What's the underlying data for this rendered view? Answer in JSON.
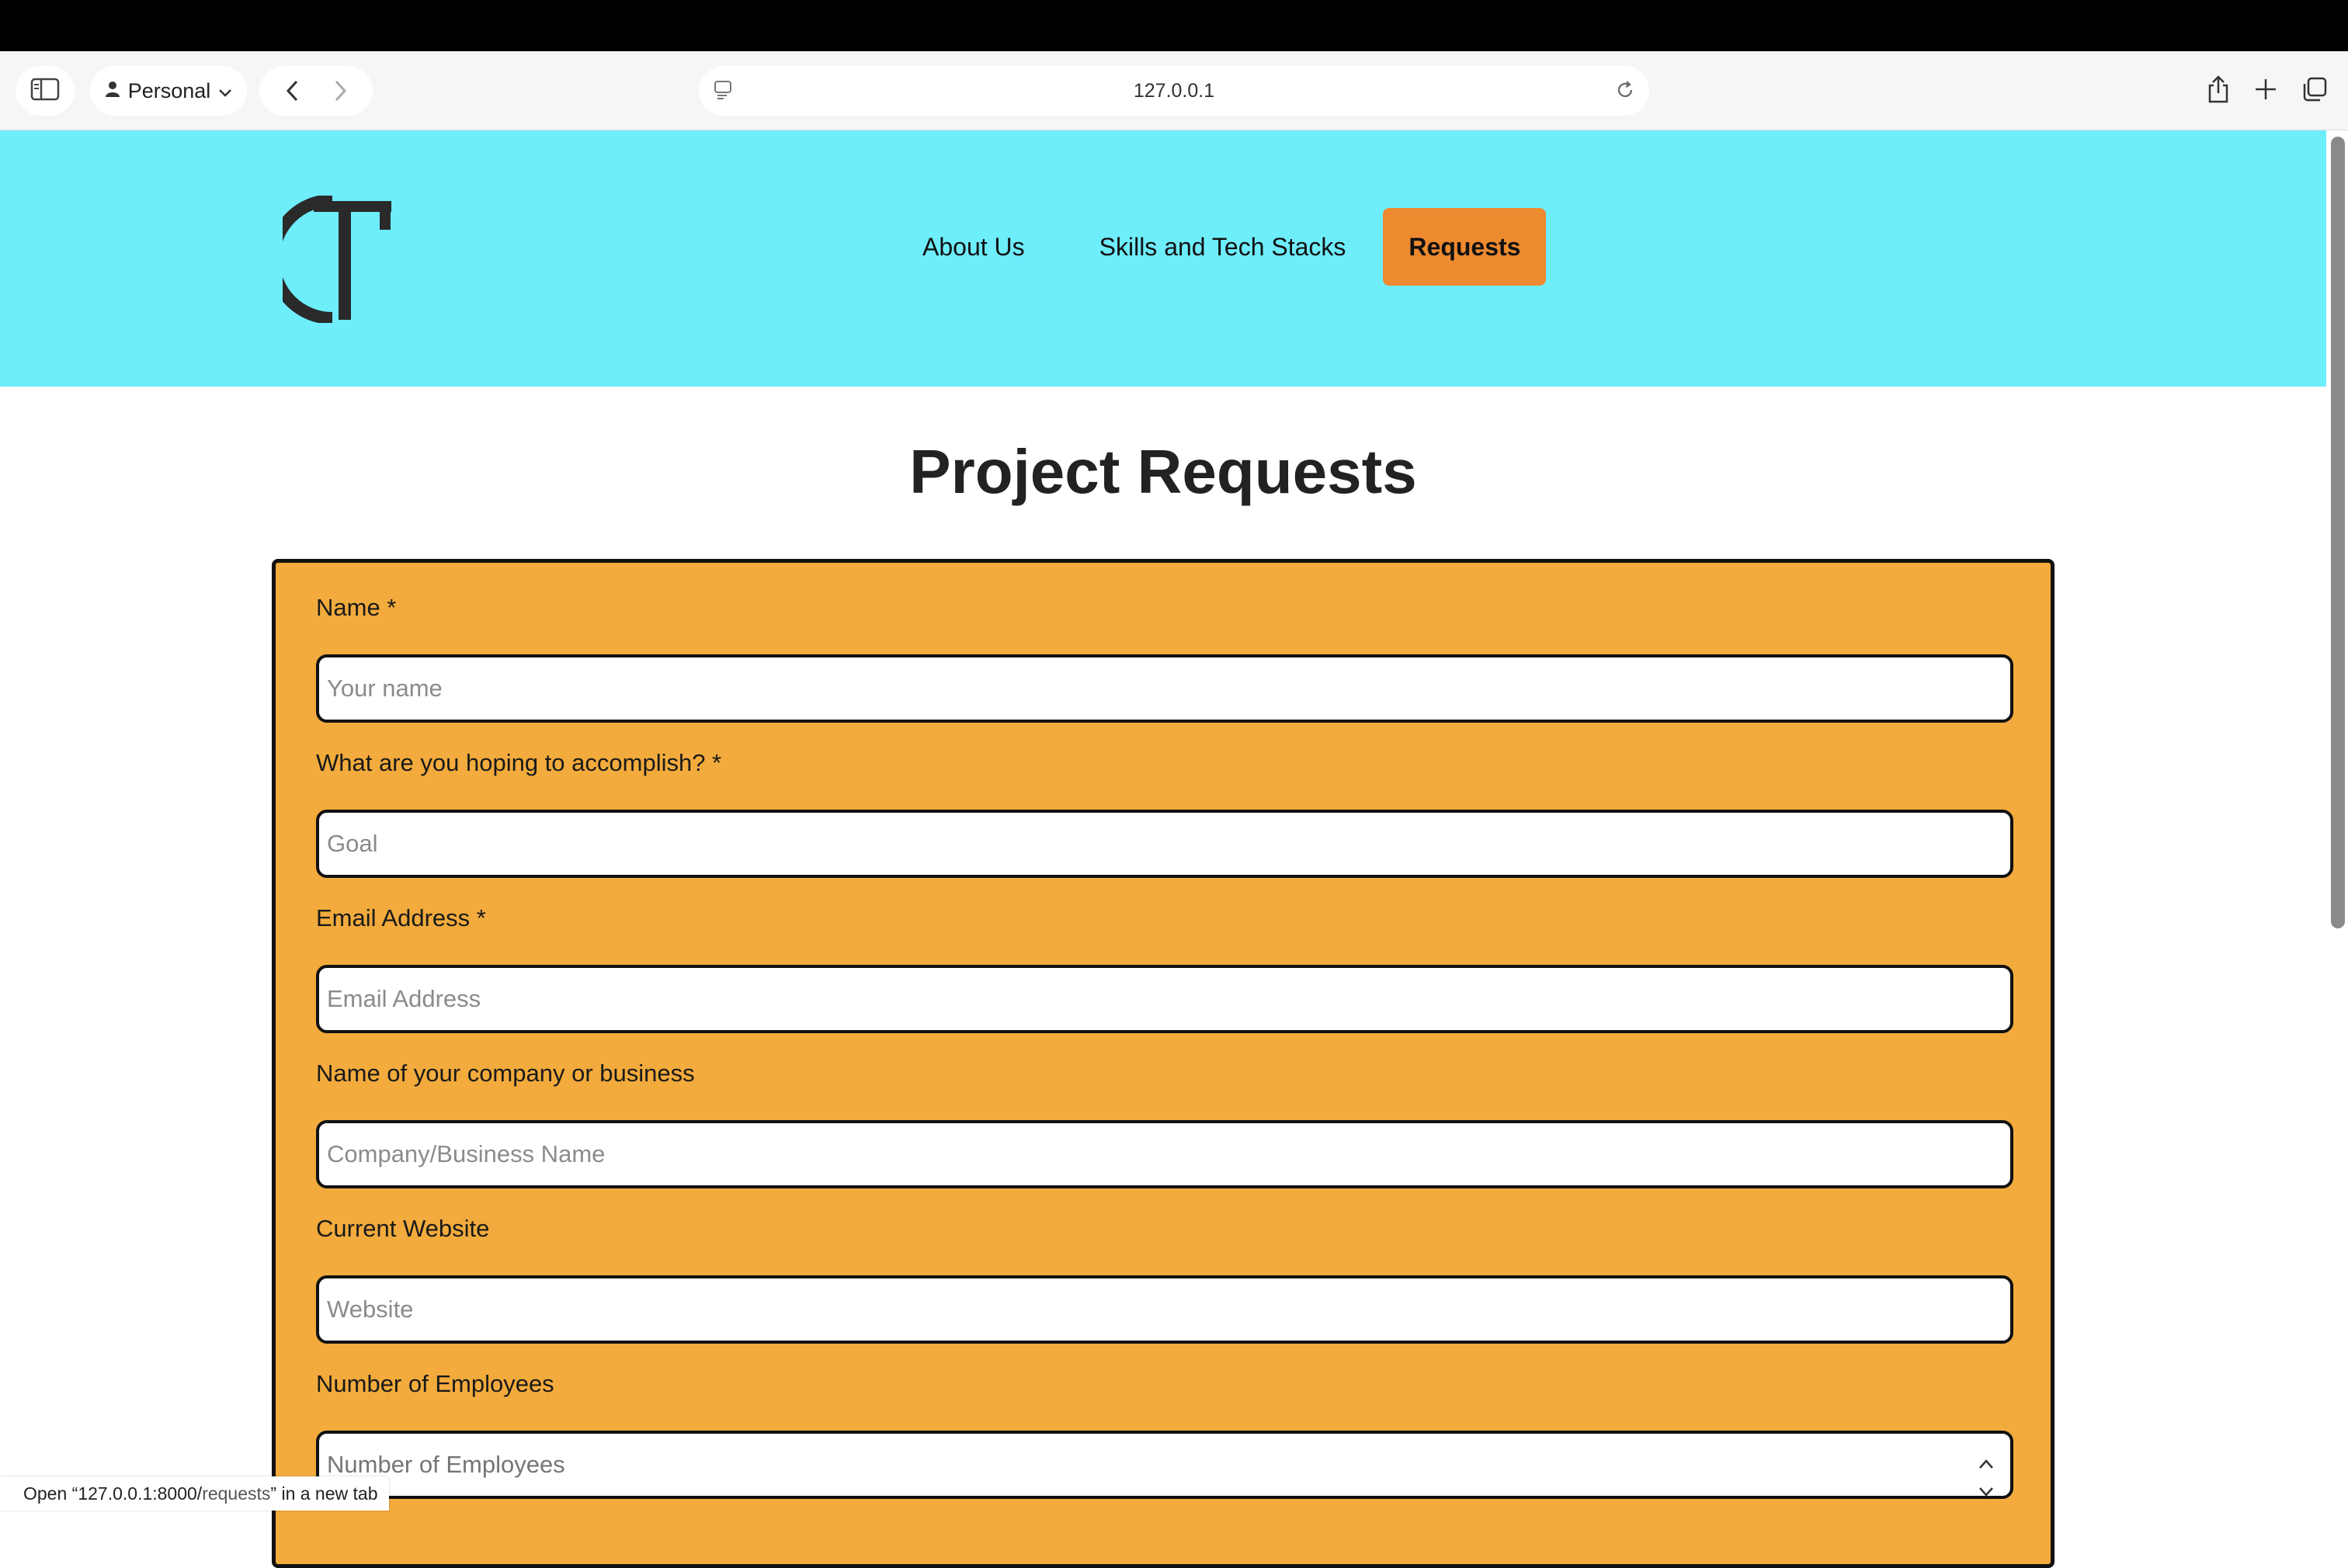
{
  "browser": {
    "profile_label": "Personal",
    "url": "127.0.0.1",
    "icons": [
      "sidebar-icon",
      "person-icon",
      "chevron-down-icon",
      "back-icon",
      "forward-icon",
      "reader-icon",
      "reload-icon",
      "share-icon",
      "new-tab-icon",
      "tabs-overview-icon"
    ]
  },
  "header": {
    "logo_text": "CT",
    "nav": {
      "about": "About Us",
      "skills": "Skills and Tech Stacks",
      "requests": "Requests"
    }
  },
  "colors": {
    "header_bg": "#6eedfb",
    "cta_bg": "#ee8a30",
    "form_bg": "#f2ab3c"
  },
  "main": {
    "title": "Project Requests",
    "fields": [
      {
        "label": "Name *",
        "placeholder": "Your name",
        "value": ""
      },
      {
        "label": "What are you hoping to accomplish? *",
        "placeholder": "Goal",
        "value": ""
      },
      {
        "label": "Email Address *",
        "placeholder": "Email Address",
        "value": ""
      },
      {
        "label": "Name of your company or business",
        "placeholder": "Company/Business Name",
        "value": ""
      },
      {
        "label": "Current Website",
        "placeholder": "Website",
        "value": ""
      },
      {
        "label": "Number of Employees",
        "placeholder": "Number of Employees",
        "value": ""
      }
    ]
  },
  "status": {
    "prefix": "Open “127.0.0.1:8000/",
    "path": "requests",
    "suffix": "” in a new tab"
  }
}
